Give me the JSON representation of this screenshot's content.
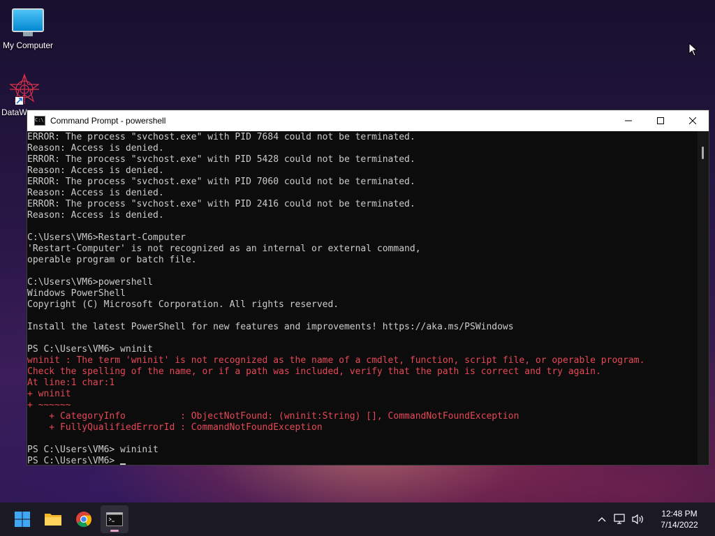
{
  "desktop": {
    "icons": [
      {
        "label": "My Computer"
      },
      {
        "label": "DataW"
      }
    ]
  },
  "window": {
    "title": "Command Prompt - powershell",
    "lines": [
      {
        "text": "ERROR: The process \"svchost.exe\" with PID 7684 could not be terminated.",
        "type": "normal"
      },
      {
        "text": "Reason: Access is denied.",
        "type": "normal"
      },
      {
        "text": "ERROR: The process \"svchost.exe\" with PID 5428 could not be terminated.",
        "type": "normal"
      },
      {
        "text": "Reason: Access is denied.",
        "type": "normal"
      },
      {
        "text": "ERROR: The process \"svchost.exe\" with PID 7060 could not be terminated.",
        "type": "normal"
      },
      {
        "text": "Reason: Access is denied.",
        "type": "normal"
      },
      {
        "text": "ERROR: The process \"svchost.exe\" with PID 2416 could not be terminated.",
        "type": "normal"
      },
      {
        "text": "Reason: Access is denied.",
        "type": "normal"
      },
      {
        "text": "",
        "type": "normal"
      },
      {
        "text": "C:\\Users\\VM6>Restart-Computer",
        "type": "normal"
      },
      {
        "text": "'Restart-Computer' is not recognized as an internal or external command,",
        "type": "normal"
      },
      {
        "text": "operable program or batch file.",
        "type": "normal"
      },
      {
        "text": "",
        "type": "normal"
      },
      {
        "text": "C:\\Users\\VM6>powershell",
        "type": "normal"
      },
      {
        "text": "Windows PowerShell",
        "type": "normal"
      },
      {
        "text": "Copyright (C) Microsoft Corporation. All rights reserved.",
        "type": "normal"
      },
      {
        "text": "",
        "type": "normal"
      },
      {
        "text": "Install the latest PowerShell for new features and improvements! https://aka.ms/PSWindows",
        "type": "normal"
      },
      {
        "text": "",
        "type": "normal"
      },
      {
        "text": "PS C:\\Users\\VM6> wninit",
        "type": "normal"
      },
      {
        "text": "wninit : The term 'wninit' is not recognized as the name of a cmdlet, function, script file, or operable program.",
        "type": "err"
      },
      {
        "text": "Check the spelling of the name, or if a path was included, verify that the path is correct and try again.",
        "type": "err"
      },
      {
        "text": "At line:1 char:1",
        "type": "err"
      },
      {
        "text": "+ wninit",
        "type": "err"
      },
      {
        "text": "+ ~~~~~~",
        "type": "err"
      },
      {
        "text": "    + CategoryInfo          : ObjectNotFound: (wninit:String) [], CommandNotFoundException",
        "type": "err"
      },
      {
        "text": "    + FullyQualifiedErrorId : CommandNotFoundException",
        "type": "err"
      },
      {
        "text": "",
        "type": "normal"
      },
      {
        "text": "PS C:\\Users\\VM6> wininit",
        "type": "normal"
      }
    ],
    "prompt": "PS C:\\Users\\VM6> "
  },
  "taskbar": {
    "apps": [
      "start-icon",
      "file-explorer-icon",
      "chrome-icon",
      "terminal-icon"
    ],
    "time": "12:48 PM",
    "date": "7/14/2022"
  },
  "colors": {
    "console_bg": "#0c0c0c",
    "console_text": "#cccccc",
    "error_text": "#e74856"
  }
}
